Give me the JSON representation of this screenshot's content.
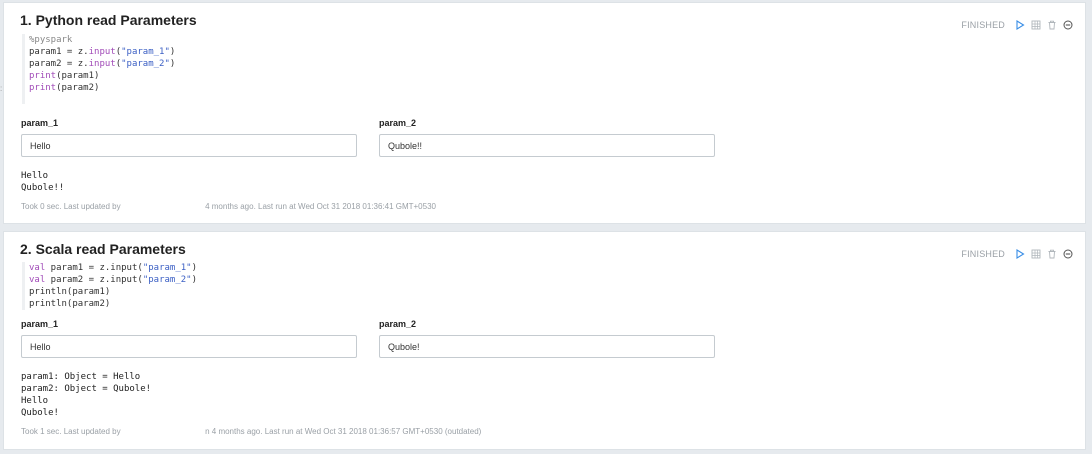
{
  "paragraphs": [
    {
      "title": "1. Python read Parameters",
      "status": "FINISHED",
      "code": {
        "prefix": "%pyspark",
        "lines": [
          {
            "a": "param1 = z.",
            "b": "input",
            "c": "(",
            "d": "\"param_1\"",
            "e": ")"
          },
          {
            "a": "param2 = z.",
            "b": "input",
            "c": "(",
            "d": "\"param_2\"",
            "e": ")"
          }
        ],
        "prints": [
          {
            "kw": "print",
            "rest": "(param1)"
          },
          {
            "kw": "print",
            "rest": "(param2)"
          }
        ]
      },
      "inputs": [
        {
          "label": "param_1",
          "value": "Hello"
        },
        {
          "label": "param_2",
          "value": "Qubole!!"
        }
      ],
      "output": [
        "Hello",
        "Qubole!!"
      ],
      "footer": {
        "took": "Took 0 sec. Last updated by",
        "rest": "4 months ago. Last run at Wed Oct 31 2018 01:36:41 GMT+0530"
      }
    },
    {
      "title": "2. Scala read Parameters",
      "status": "FINISHED",
      "code": {
        "vals": [
          {
            "kw": "val",
            "a": " param1 = z.input(",
            "d": "\"param_1\"",
            "e": ")"
          },
          {
            "kw": "val",
            "a": " param2 = z.input(",
            "d": "\"param_2\"",
            "e": ")"
          }
        ],
        "prints": [
          "println(param1)",
          "println(param2)"
        ]
      },
      "inputs": [
        {
          "label": "param_1",
          "value": "Hello"
        },
        {
          "label": "param_2",
          "value": "Qubole!"
        }
      ],
      "output": [
        "param1: Object = Hello",
        "param2: Object = Qubole!",
        "Hello",
        "Qubole!"
      ],
      "footer": {
        "took": "Took 1 sec. Last updated by",
        "rest": "n 4 months ago. Last run at Wed Oct 31 2018 01:36:57 GMT+0530 (outdated)"
      }
    }
  ],
  "icons": {
    "run": "play-icon",
    "table": "grid-icon",
    "delete": "trash-icon",
    "settings": "circle-minus-icon"
  },
  "colors": {
    "run_icon": "#3a8ee6",
    "icon_gray": "#9aa0a6"
  }
}
